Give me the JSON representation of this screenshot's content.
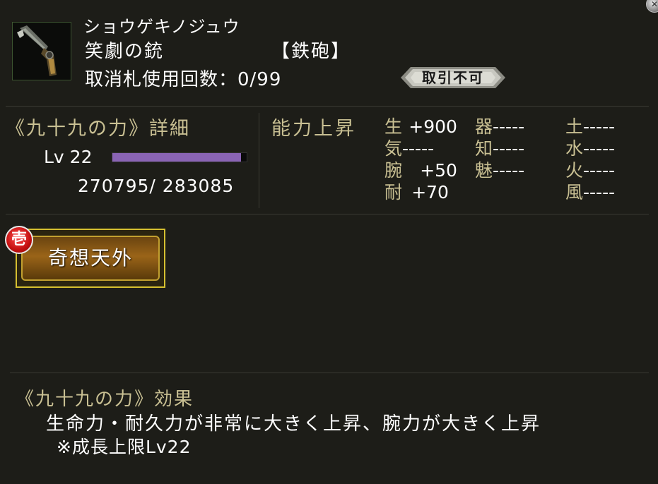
{
  "item": {
    "kana": "ショウゲキノジュウ",
    "name": "笑劇の銃",
    "type": "【鉄砲】",
    "uses_label": "取消札使用回数：0/99",
    "badge": "取引不可",
    "icon": "gun-icon"
  },
  "detail": {
    "title": "《九十九の力》詳細",
    "lv_label": "Lv 22",
    "level": 22,
    "exp_current": 270795,
    "exp_max": 283085,
    "exp_progress": 0.957,
    "exp_text": "270795/   283085"
  },
  "abilities": {
    "title": "能力上昇",
    "stats": [
      {
        "key": "生",
        "value": "+900"
      },
      {
        "key": "気",
        "value": "-----"
      },
      {
        "key": "腕",
        "value": "+50"
      },
      {
        "key": "耐",
        "value": "+70"
      },
      {
        "key": "器",
        "value": "-----"
      },
      {
        "key": "知",
        "value": "-----"
      },
      {
        "key": "魅",
        "value": "-----"
      },
      {
        "key": "土",
        "value": "-----"
      },
      {
        "key": "水",
        "value": "-----"
      },
      {
        "key": "火",
        "value": "-----"
      },
      {
        "key": "風",
        "value": "-----"
      }
    ]
  },
  "skill": {
    "rank": "壱",
    "label": "奇想天外"
  },
  "effect": {
    "title": "《九十九の力》効果",
    "description": "生命力・耐久力が非常に大きく上昇、腕力が大きく上昇",
    "note": "※成長上限Lv22"
  },
  "colors": {
    "background": "#1d1d18",
    "label_gold": "#c9c093",
    "exp_bar": "#8a64b4",
    "badge_red": "#c40f0f",
    "skill_border": "#d6c030"
  }
}
